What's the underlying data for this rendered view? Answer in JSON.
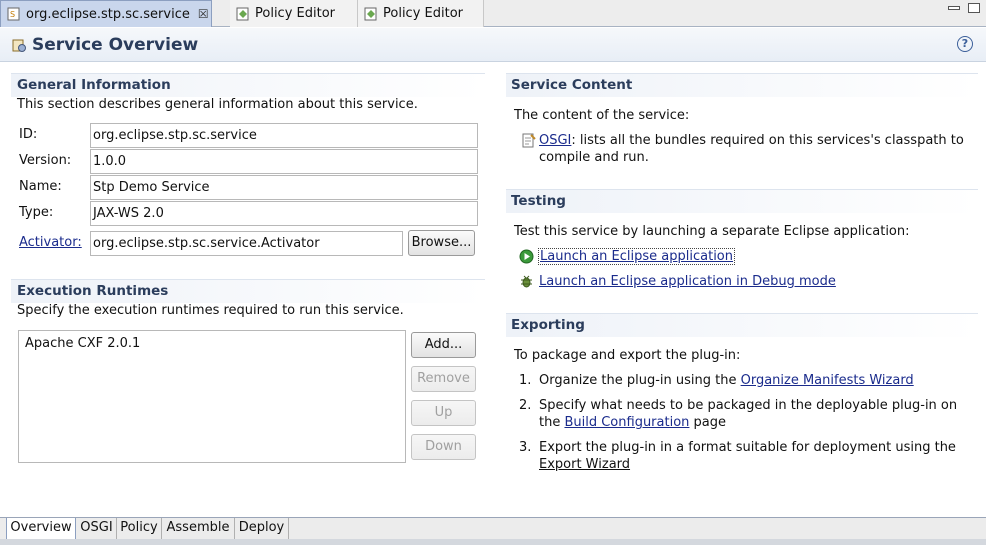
{
  "editor_tabs": [
    {
      "label": "org.eclipse.stp.sc.service",
      "active": true,
      "closable": true,
      "icon": "service-file-icon"
    },
    {
      "label": "Policy Editor",
      "active": false,
      "icon": "policy-icon"
    },
    {
      "label": "Policy Editor",
      "active": false,
      "icon": "policy-icon"
    }
  ],
  "header": {
    "title": "Service Overview",
    "help": "?"
  },
  "general": {
    "title": "General Information",
    "description": "This section describes general information about this service.",
    "id_label": "ID:",
    "id_value": "org.eclipse.stp.sc.service",
    "version_label": "Version:",
    "version_value": "1.0.0",
    "name_label": "Name:",
    "name_value": "Stp Demo Service",
    "type_label": "Type:",
    "type_value": "JAX-WS 2.0",
    "activator_label": "Activator:",
    "activator_value": "org.eclipse.stp.sc.service.Activator",
    "browse_label": "Browse..."
  },
  "runtimes": {
    "title": "Execution Runtimes",
    "description": "Specify the execution runtimes required to run this service.",
    "items": [
      "Apache CXF 2.0.1"
    ],
    "add_label": "Add...",
    "remove_label": "Remove",
    "up_label": "Up",
    "down_label": "Down"
  },
  "content": {
    "title": "Service Content",
    "description": "The content of the service:",
    "osgi_link": "OSGI",
    "osgi_text_1": ": lists all the bundles required on this services's classpath to",
    "osgi_text_2": "compile and run."
  },
  "testing": {
    "title": "Testing",
    "description": "Test this service by launching a separate Eclipse application:",
    "launch_link": "Launch an Eclipse application",
    "debug_link": "Launch an Eclipse application in Debug mode"
  },
  "exporting": {
    "title": "Exporting",
    "description": "To package and export the plug-in:",
    "step1_num": "1.",
    "step1_text": "Organize the plug-in using the ",
    "step1_link": "Organize Manifests Wizard",
    "step2_num": "2.",
    "step2_text_1": "Specify what needs to be packaged in the deployable plug-in on",
    "step2_text_2a": "the ",
    "step2_link": "Build Configuration",
    "step2_text_2b": " page",
    "step3_num": "3.",
    "step3_text": "Export the plug-in in a format suitable for deployment using the",
    "step3_link": "Export Wizard"
  },
  "bottom_tabs": [
    {
      "label": "Overview",
      "active": true
    },
    {
      "label": "OSGI"
    },
    {
      "label": "Policy"
    },
    {
      "label": "Assemble"
    },
    {
      "label": "Deploy"
    }
  ],
  "colors": {
    "section_title": "#2b3d5c",
    "link": "#1a2b8c",
    "active_tab": "#c9d6ec"
  }
}
